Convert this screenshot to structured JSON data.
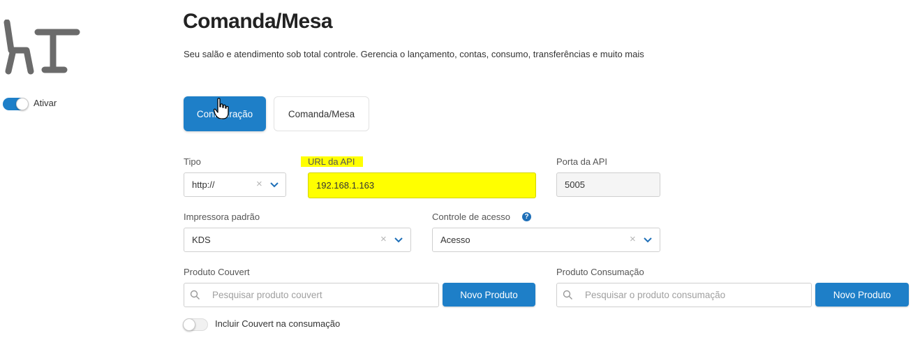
{
  "sidebar": {
    "logo_icon": "table-chair-icon",
    "toggle_label": "Ativar",
    "toggle_on": true
  },
  "header": {
    "title": "Comanda/Mesa",
    "subtitle": "Seu salão e atendimento sob total controle. Gerencia o lançamento, contas, consumo, transferências e muito mais"
  },
  "tabs": [
    {
      "label": "Configuração",
      "active": true
    },
    {
      "label": "Comanda/Mesa",
      "active": false
    }
  ],
  "form": {
    "tipo": {
      "label": "Tipo",
      "value": "http://"
    },
    "url_api": {
      "label": "URL da API",
      "value": "192.168.1.163"
    },
    "porta_api": {
      "label": "Porta da API",
      "value": "5005"
    },
    "impressora": {
      "label": "Impressora padrão",
      "value": "KDS"
    },
    "controle_acesso": {
      "label": "Controle de acesso",
      "value": "Acesso",
      "help_icon": "question-circle-icon"
    },
    "produto_couvert": {
      "label": "Produto Couvert",
      "placeholder": "Pesquisar produto couvert",
      "button": "Novo Produto"
    },
    "produto_consumacao": {
      "label": "Produto Consumação",
      "placeholder": "Pesquisar o produto consumação",
      "button": "Novo Produto"
    },
    "incluir_couvert": {
      "label": "Incluir Couvert na consumação",
      "on": false
    }
  },
  "colors": {
    "accent": "#1e7fc8",
    "highlight": "#ffff00",
    "logo": "#6b6b6b"
  }
}
